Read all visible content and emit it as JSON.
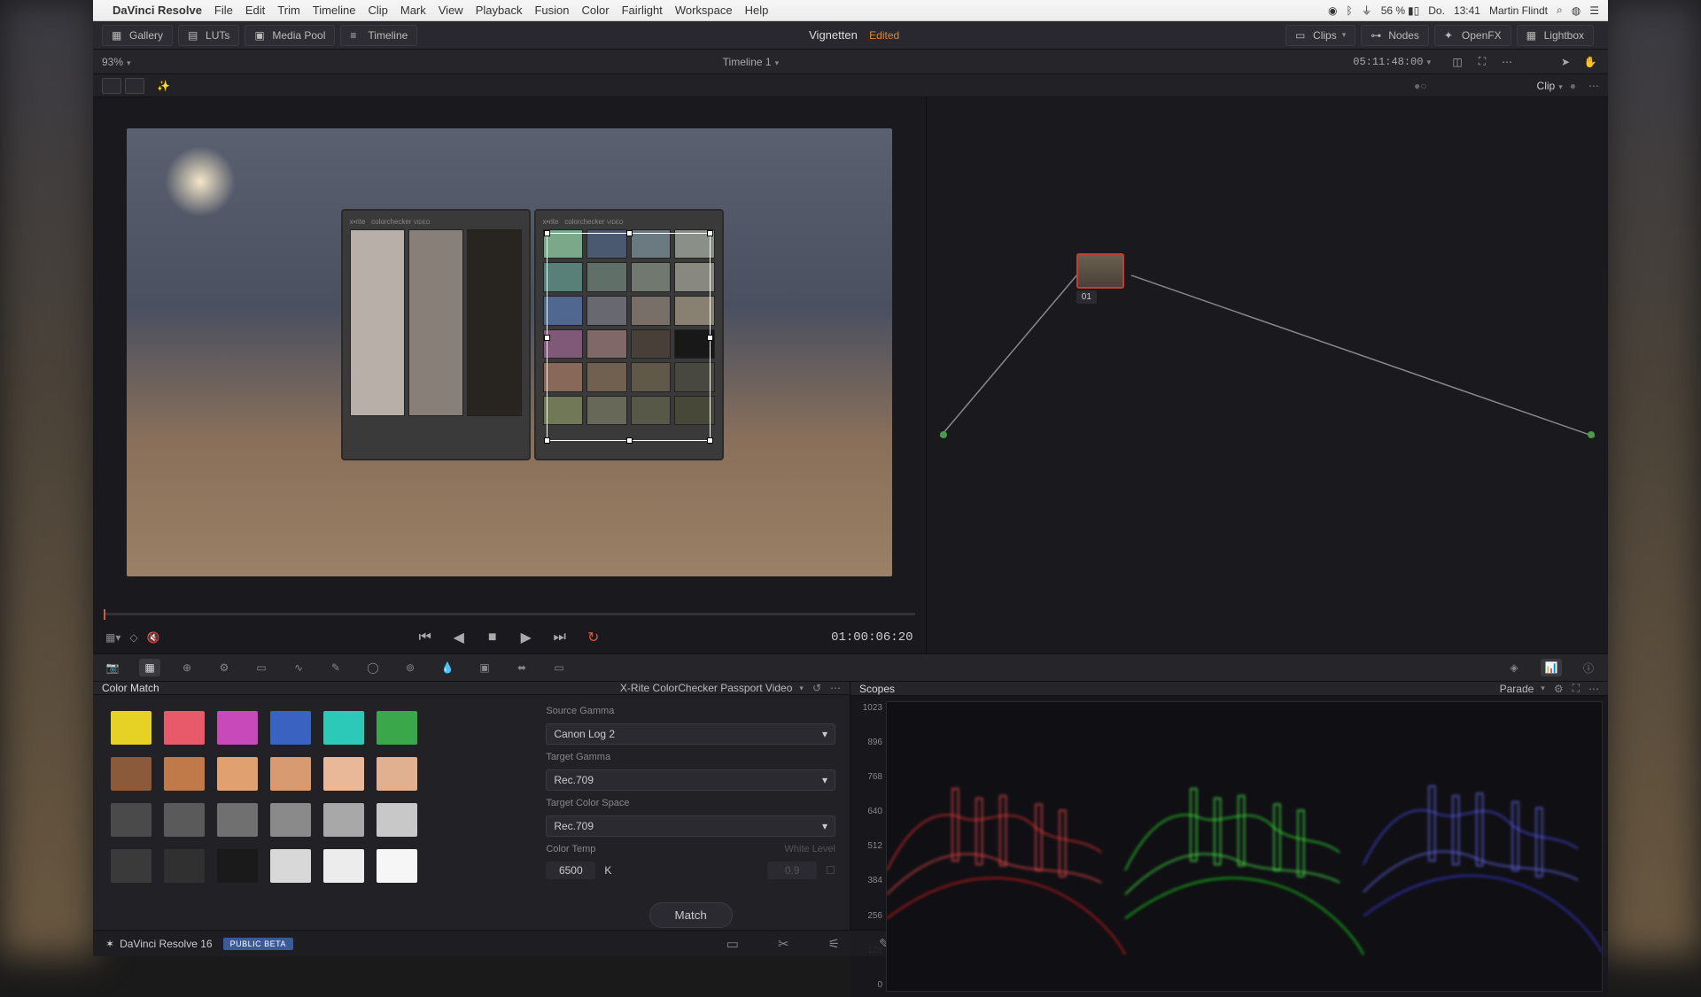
{
  "menubar": {
    "app_name": "DaVinci Resolve",
    "items": [
      "File",
      "Edit",
      "Trim",
      "Timeline",
      "Clip",
      "Mark",
      "View",
      "Playback",
      "Fusion",
      "Color",
      "Fairlight",
      "Workspace",
      "Help"
    ],
    "battery": "56 %",
    "day": "Do.",
    "time": "13:41",
    "user": "Martin Flindt"
  },
  "toolbar": {
    "left": [
      {
        "icon": "gallery-icon",
        "label": "Gallery"
      },
      {
        "icon": "luts-icon",
        "label": "LUTs"
      },
      {
        "icon": "mediapool-icon",
        "label": "Media Pool"
      },
      {
        "icon": "timeline-icon",
        "label": "Timeline"
      }
    ],
    "project": "Vignetten",
    "status": "Edited",
    "right": [
      {
        "icon": "clips-icon",
        "label": "Clips"
      },
      {
        "icon": "nodes-icon",
        "label": "Nodes"
      },
      {
        "icon": "openfx-icon",
        "label": "OpenFX"
      },
      {
        "icon": "lightbox-icon",
        "label": "Lightbox"
      }
    ]
  },
  "timeline_row": {
    "zoom": "93%",
    "name": "Timeline 1",
    "timecode": "05:11:48:00",
    "clip_label": "Clip"
  },
  "transport": {
    "timecode": "01:00:06:20"
  },
  "node_graph": {
    "node_label": "01"
  },
  "color_match": {
    "title": "Color Match",
    "chart_preset": "X-Rite ColorChecker Passport Video",
    "swatches": [
      [
        "#e6d224",
        "#e85a6a",
        "#c84aba",
        "#3a62c0",
        "#2cc8b8",
        "#3aa84a"
      ],
      [
        "#8a5a3a",
        "#c07a4a",
        "#e0a070",
        "#d89a70",
        "#e8b898",
        "#e0b090"
      ],
      [
        "#4a4a4a",
        "#5a5a5a",
        "#707070",
        "#8a8a8a",
        "#a8a8a8",
        "#c8c8c8"
      ],
      [
        "#3a3a3a",
        "#303030",
        "#1a1a1a",
        "#d8d8d8",
        "#ececec",
        "#f6f6f6"
      ]
    ],
    "source_gamma_label": "Source Gamma",
    "source_gamma": "Canon Log 2",
    "target_gamma_label": "Target Gamma",
    "target_gamma": "Rec.709",
    "target_cs_label": "Target Color Space",
    "target_cs": "Rec.709",
    "color_temp_label": "Color Temp",
    "white_level_label": "White Level",
    "color_temp": "6500",
    "color_temp_unit": "K",
    "white_level": "0.9",
    "match_label": "Match"
  },
  "scopes": {
    "title": "Scopes",
    "mode": "Parade",
    "yticks": [
      "1023",
      "896",
      "768",
      "640",
      "512",
      "384",
      "256",
      "128",
      "0"
    ]
  },
  "footer": {
    "product": "DaVinci Resolve 16",
    "beta": "PUBLIC BETA"
  },
  "checker_right_colors": [
    "#7aa888",
    "#4a5870",
    "#6a7a80",
    "#8a9088",
    "#588078",
    "#607068",
    "#707870",
    "#888880",
    "#506890",
    "#686870",
    "#787068",
    "#888070",
    "#805878",
    "#806868",
    "#484038",
    "#181818",
    "#886858",
    "#706050",
    "#605848",
    "#484840",
    "#707858",
    "#686858",
    "#585848",
    "#484838"
  ]
}
